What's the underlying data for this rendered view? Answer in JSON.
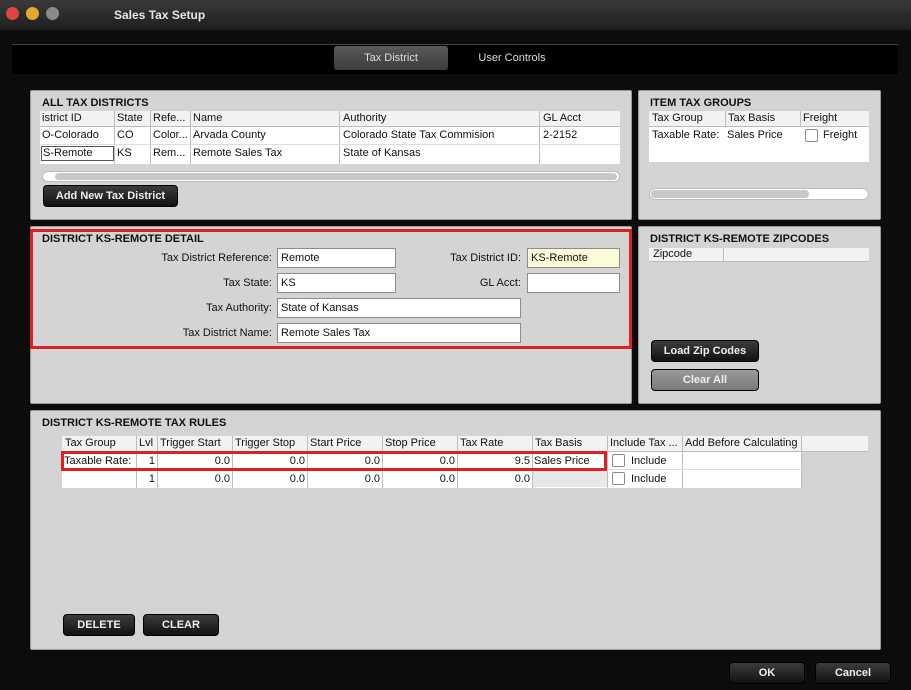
{
  "window": {
    "title": "Sales Tax Setup"
  },
  "tabs": [
    {
      "label": "Tax District"
    },
    {
      "label": "User Controls"
    }
  ],
  "all_districts": {
    "title": "ALL TAX DISTRICTS",
    "columns": [
      "istrict ID",
      "State",
      "Refe...",
      "Name",
      "Authority",
      "GL Acct"
    ],
    "rows": [
      [
        "O-Colorado",
        "CO",
        "Color...",
        "Arvada County",
        "Colorado State Tax Commision",
        "2-2152"
      ],
      [
        "S-Remote",
        "KS",
        "Rem...",
        "Remote Sales Tax",
        "State of Kansas",
        ""
      ]
    ],
    "add_button": "Add New Tax District"
  },
  "item_tax_groups": {
    "title": "ITEM TAX GROUPS",
    "columns": [
      "Tax Group",
      "Tax Basis",
      "Freight"
    ],
    "row": {
      "group": "Taxable Rate:",
      "basis": "Sales Price",
      "freight": "Freight"
    }
  },
  "detail": {
    "title": "DISTRICT KS-REMOTE DETAIL",
    "ref_label": "Tax District Reference:",
    "ref_value": "Remote",
    "id_label": "Tax District ID:",
    "id_value": "KS-Remote",
    "state_label": "Tax State:",
    "state_value": "KS",
    "gl_label": "GL Acct:",
    "gl_value": "",
    "authority_label": "Tax Authority:",
    "authority_value": "State of Kansas",
    "name_label": "Tax District Name:",
    "name_value": "Remote Sales Tax"
  },
  "zipcodes": {
    "title": "DISTRICT KS-REMOTE ZIPCODES",
    "column": "Zipcode",
    "load_button": "Load Zip Codes",
    "clear_button": "Clear All"
  },
  "tax_rules": {
    "title": "DISTRICT KS-REMOTE TAX RULES",
    "columns": [
      "Tax Group",
      "Lvl",
      "Trigger Start",
      "Trigger Stop",
      "Start Price",
      "Stop Price",
      "Tax Rate",
      "Tax Basis",
      "Include Tax ...",
      "Add Before Calculating"
    ],
    "rows": [
      {
        "group": "Taxable Rate:",
        "lvl": "1",
        "tstart": "0.0",
        "tstop": "0.0",
        "pstart": "0.0",
        "pstop": "0.0",
        "rate": "9.5",
        "basis": "Sales Price",
        "include": "Include"
      },
      {
        "group": "",
        "lvl": "1",
        "tstart": "0.0",
        "tstop": "0.0",
        "pstart": "0.0",
        "pstop": "0.0",
        "rate": "0.0",
        "basis": "",
        "include": "Include"
      }
    ],
    "delete_button": "DELETE",
    "clear_button": "CLEAR"
  },
  "footer": {
    "ok": "OK",
    "cancel": "Cancel"
  }
}
